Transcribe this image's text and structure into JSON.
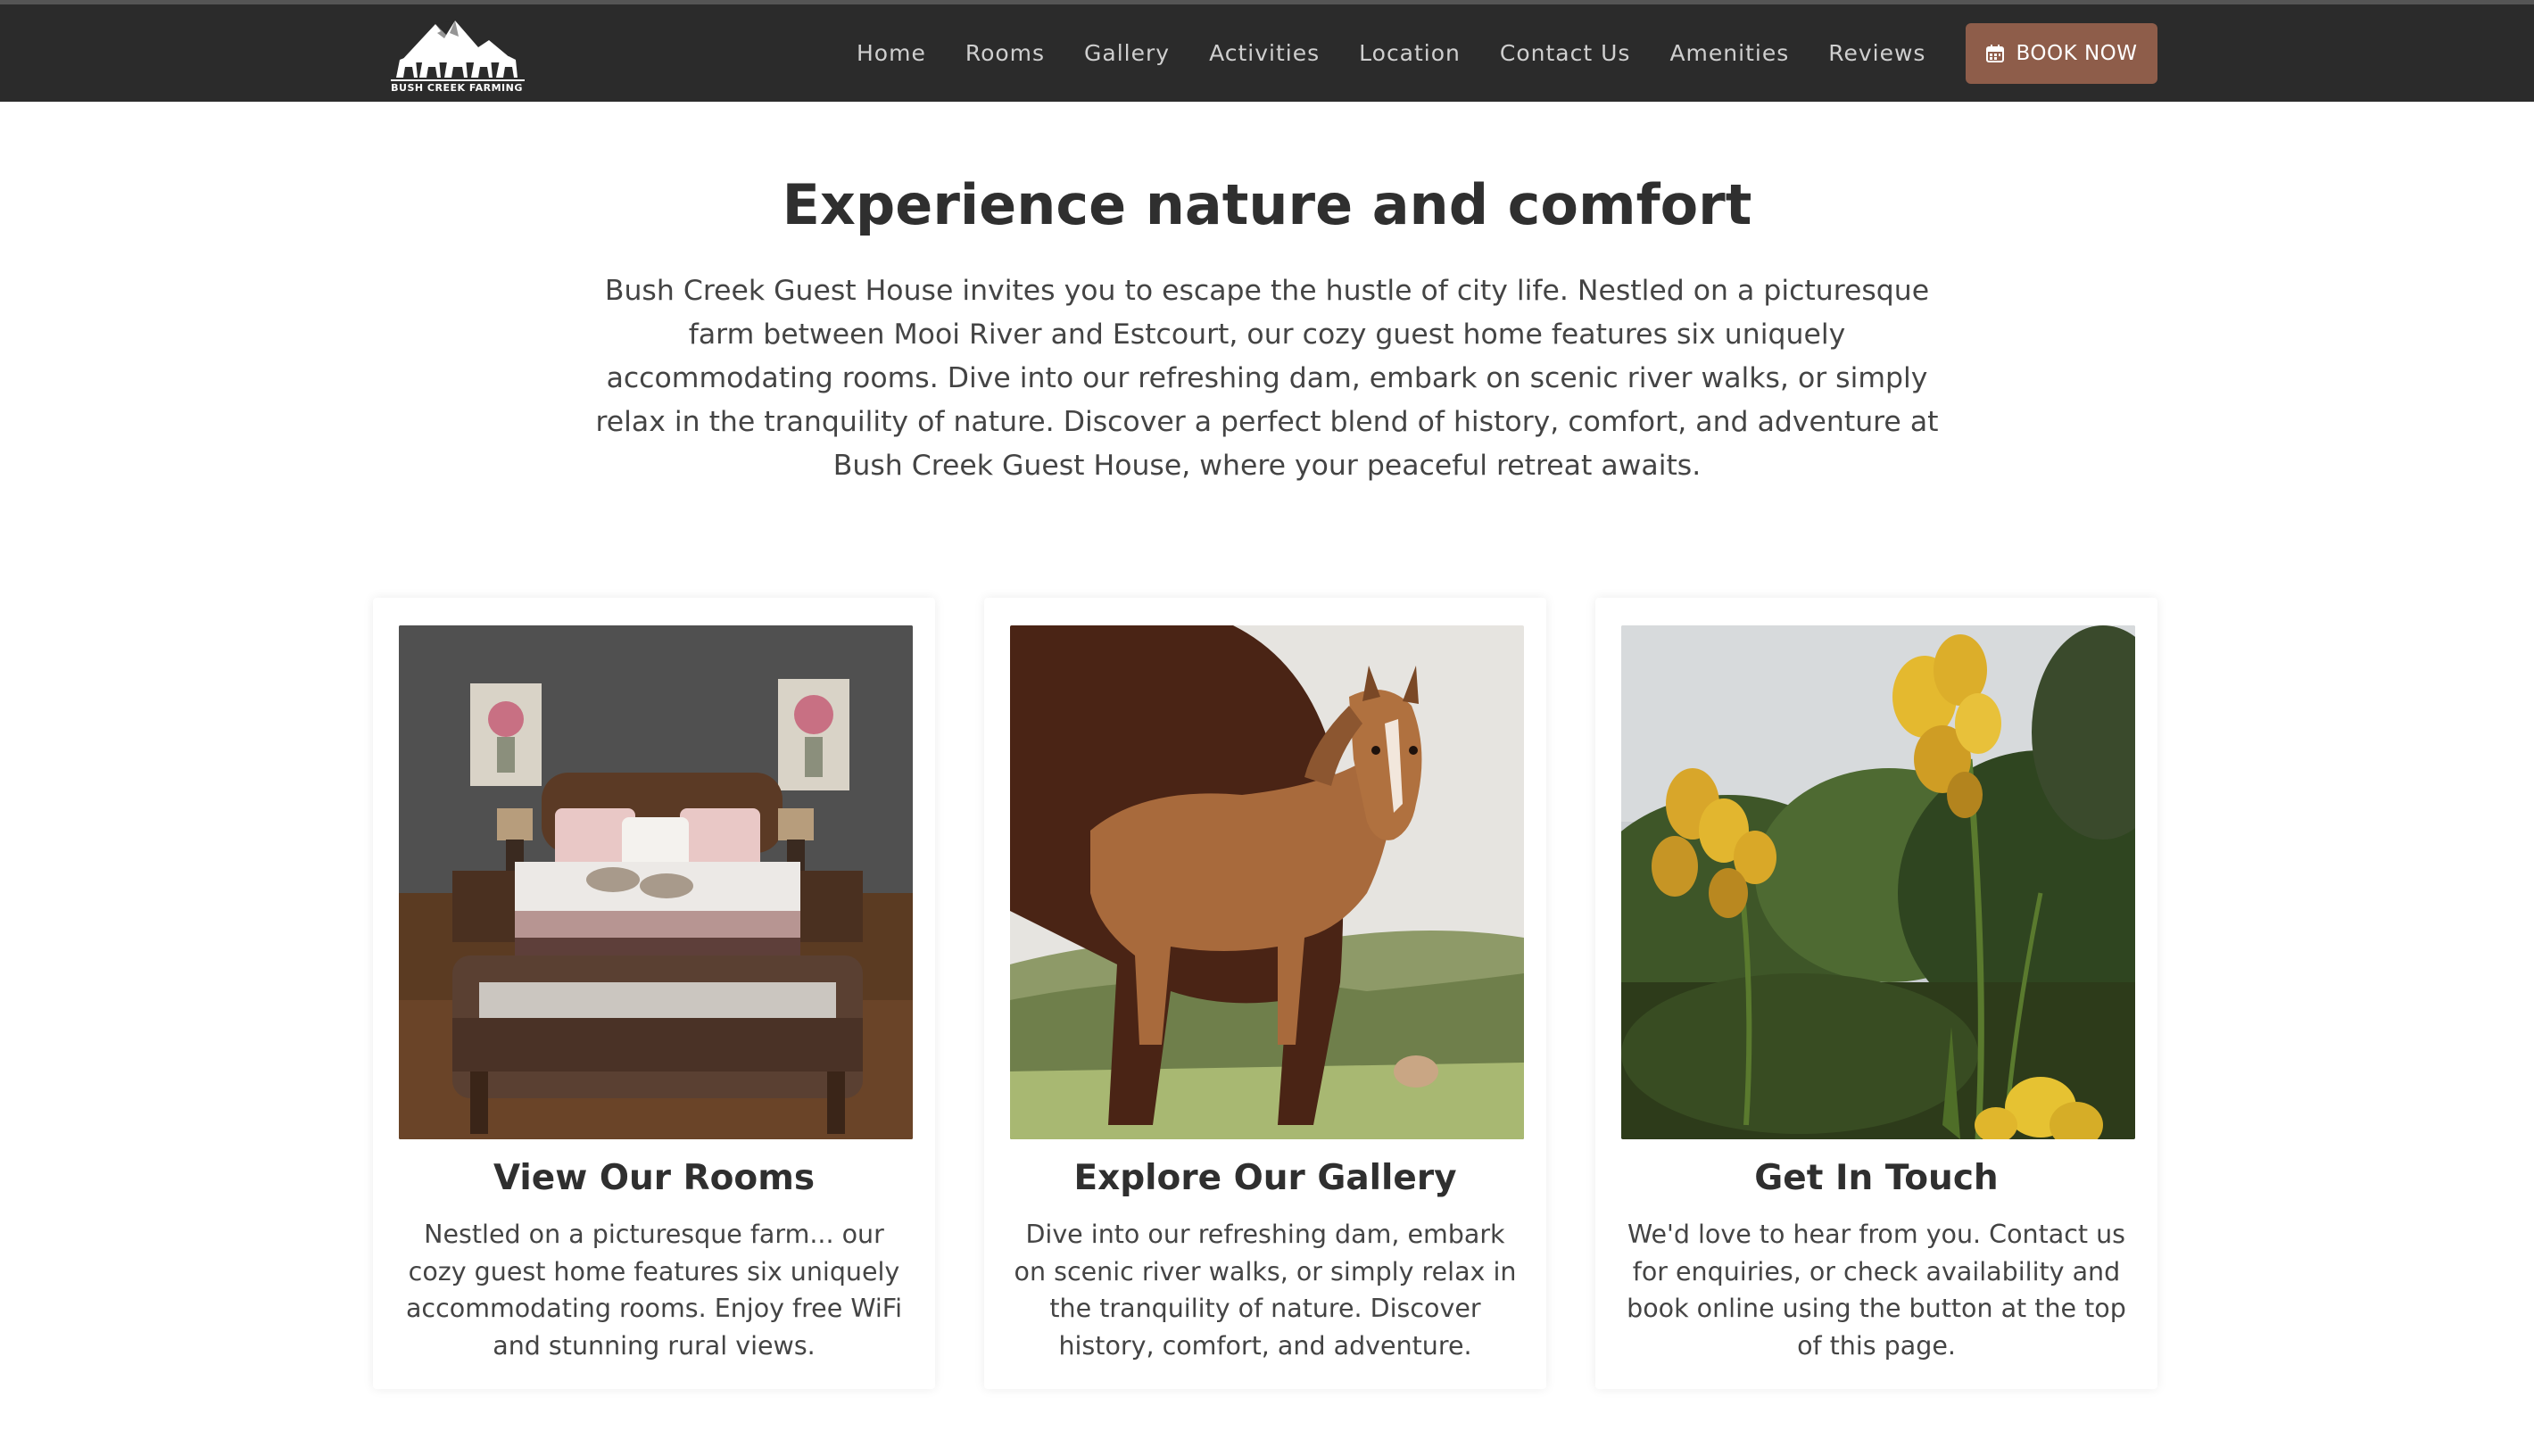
{
  "brand": {
    "logo_text": "BUSH CREEK FARMING"
  },
  "nav": {
    "items": [
      {
        "label": "Home"
      },
      {
        "label": "Rooms"
      },
      {
        "label": "Gallery"
      },
      {
        "label": "Activities"
      },
      {
        "label": "Location"
      },
      {
        "label": "Contact Us"
      },
      {
        "label": "Amenities"
      },
      {
        "label": "Reviews"
      }
    ],
    "book_label": "BOOK NOW",
    "book_icon": "calendar-icon"
  },
  "hero": {
    "title": "Experience nature and comfort",
    "text": "Bush Creek Guest House invites you to escape the hustle of city life. Nestled on a picturesque farm between Mooi River and Estcourt, our cozy guest home features six uniquely accommodating rooms. Dive into our refreshing dam, embark on scenic river walks, or simply relax in the tranquility of nature. Discover a perfect blend of history, comfort, and adventure at Bush Creek Guest House, where your peaceful retreat awaits."
  },
  "cards": [
    {
      "title": "View Our Rooms",
      "text": "Nestled on a picturesque farm... our cozy guest home features six uniquely accommodating rooms. Enjoy free WiFi and stunning rural views."
    },
    {
      "title": "Explore Our Gallery",
      "text": "Dive into our refreshing dam, embark on scenic river walks, or simply relax in the tranquility of nature. Discover history, comfort, and adventure."
    },
    {
      "title": "Get In Touch",
      "text": "We'd love to hear from you. Contact us for enquiries, or check availability and book online using the button at the top of this page."
    }
  ],
  "colors": {
    "navbar": "#2b2b2b",
    "accent": "#8e5d4a",
    "heading": "#2f2f2f",
    "body_text": "#444444"
  }
}
